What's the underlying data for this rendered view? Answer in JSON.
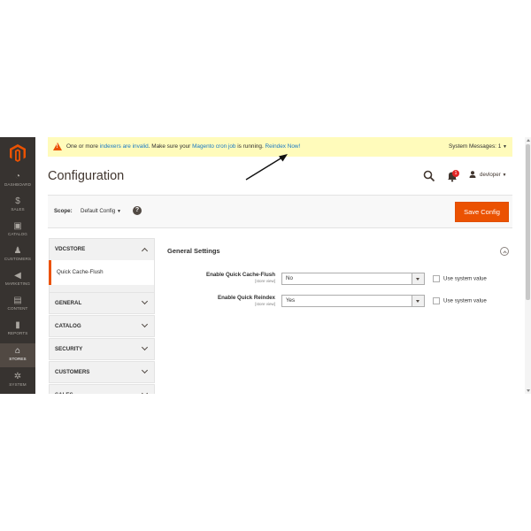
{
  "menu": {
    "items": [
      {
        "icon": "dashboard-icon",
        "glyph": "◔",
        "label": "DASHBOARD"
      },
      {
        "icon": "dollar-icon",
        "glyph": "$",
        "label": "SALES"
      },
      {
        "icon": "box-icon",
        "glyph": "▣",
        "label": "CATALOG"
      },
      {
        "icon": "person-icon",
        "glyph": "♟",
        "label": "CUSTOMERS"
      },
      {
        "icon": "megaphone-icon",
        "glyph": "◀",
        "label": "MARKETING"
      },
      {
        "icon": "content-icon",
        "glyph": "▤",
        "label": "CONTENT"
      },
      {
        "icon": "bar-chart-icon",
        "glyph": "▮",
        "label": "REPORTS"
      },
      {
        "icon": "store-icon",
        "glyph": "⌂",
        "label": "STORES"
      },
      {
        "icon": "gear-icon",
        "glyph": "✲",
        "label": "SYSTEM"
      }
    ],
    "active_label": "STORES"
  },
  "messages": {
    "prefix": "One or more ",
    "link1": "indexers are invalid",
    "middle": ". Make sure your ",
    "link2": "Magento cron job",
    "suffix": " is running. ",
    "link3": "Reindex Now!",
    "system_messages": "System Messages: 1"
  },
  "header": {
    "title": "Configuration",
    "notifications_count": "1",
    "username": "devloper"
  },
  "scope": {
    "label": "Scope:",
    "value": "Default Config",
    "help": "?",
    "save_label": "Save Config"
  },
  "tabs": {
    "group_title": "VDCSTORE",
    "sub_item": "Quick Cache-Flush",
    "sections": [
      "GENERAL",
      "CATALOG",
      "SECURITY",
      "CUSTOMERS",
      "SALES"
    ]
  },
  "settings": {
    "section_title": "General Settings",
    "fields": [
      {
        "label": "Enable Quick Cache-Flush",
        "scope": "[store view]",
        "value": "No",
        "use_system": "Use system value"
      },
      {
        "label": "Enable Quick Reindex",
        "scope": "[store view]",
        "value": "Yes",
        "use_system": "Use system value"
      }
    ]
  },
  "colors": {
    "accent": "#eb5202",
    "menu_bg": "#373330",
    "message_bg": "#fffbbb",
    "link": "#1979c3"
  }
}
